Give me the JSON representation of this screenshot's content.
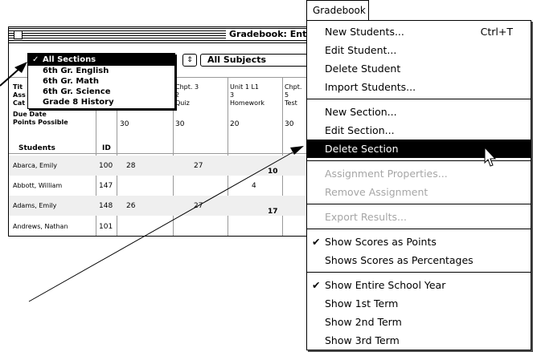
{
  "window": {
    "title": "Gradebook: Entire",
    "sections_popup_arrow": "⇕",
    "subjects_popup": "All Subjects"
  },
  "sections_menu": {
    "items": [
      {
        "label": "All Sections",
        "checked": true
      },
      {
        "label": "6th Gr. English"
      },
      {
        "label": "6th Gr. Math"
      },
      {
        "label": "6th Gr. Science"
      },
      {
        "label": "Grade 8 History"
      }
    ],
    "check": "✓"
  },
  "grid": {
    "row_labels": [
      "Tit",
      "Ass",
      "Cat",
      "Due Date",
      "Points Possible"
    ],
    "columns": [
      {
        "lines": [
          "Chpt. 3",
          "2",
          "Quiz"
        ],
        "points": "30"
      },
      {
        "lines": [
          "Unit 1 L1",
          "3",
          "Homework"
        ],
        "points": "20"
      },
      {
        "lines": [
          "Chpt.",
          "5",
          "Test"
        ],
        "points": "30"
      }
    ],
    "first_points": "30",
    "students_header": "Students",
    "id_header": "ID",
    "students": [
      {
        "name": "Abarca, Emily",
        "id": "100",
        "s1": "28",
        "s2": "27",
        "s3": "10"
      },
      {
        "name": "Abbott, William",
        "id": "147",
        "s1": "",
        "s2": "",
        "s3": "4"
      },
      {
        "name": "Adams, Emily",
        "id": "148",
        "s1": "26",
        "s2": "27",
        "s3": "17"
      },
      {
        "name": "Andrews, Nathan",
        "id": "101",
        "s1": "",
        "s2": "",
        "s3": ""
      }
    ]
  },
  "menubar": {
    "title": "Gradebook"
  },
  "gradebook_menu": {
    "groups": [
      [
        {
          "label": "New Students...",
          "shortcut": "Ctrl+T"
        },
        {
          "label": "Edit Student..."
        },
        {
          "label": "Delete Student"
        },
        {
          "label": "Import Students..."
        }
      ],
      [
        {
          "label": "New Section..."
        },
        {
          "label": "Edit Section..."
        },
        {
          "label": "Delete Section",
          "highlighted": true
        }
      ],
      [
        {
          "label": "Assignment Properties...",
          "disabled": true
        },
        {
          "label": "Remove Assignment",
          "disabled": true
        }
      ],
      [
        {
          "label": "Export Results...",
          "disabled": true
        }
      ],
      [
        {
          "label": "Show Scores as Points",
          "checked": true
        },
        {
          "label": "Shows Scores as Percentages"
        }
      ],
      [
        {
          "label": "Show Entire School Year",
          "checked": true
        },
        {
          "label": "Show 1st Term"
        },
        {
          "label": "Show 2nd Term"
        },
        {
          "label": "Show 3rd Term"
        }
      ]
    ],
    "check": "✔"
  }
}
